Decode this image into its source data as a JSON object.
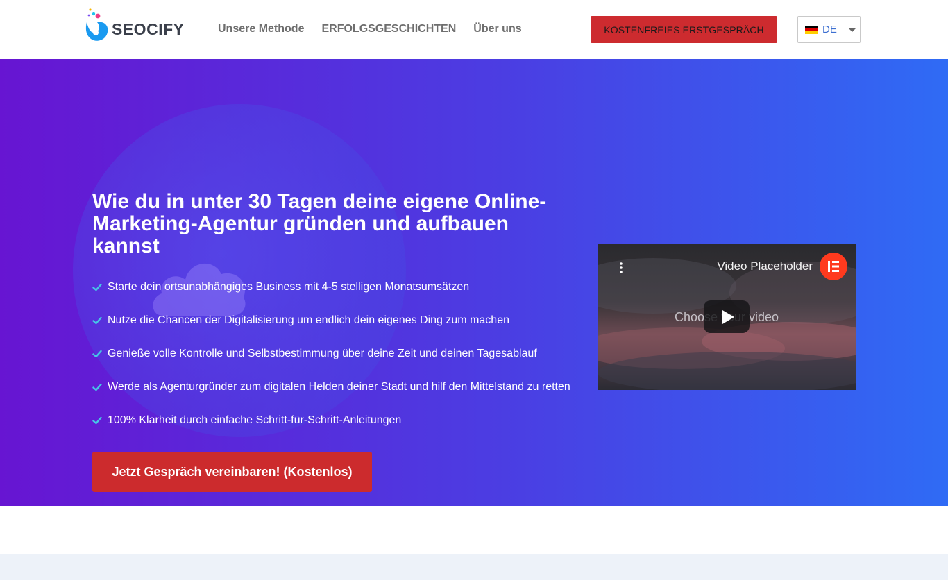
{
  "header": {
    "logo_text": "SEOCIFY",
    "nav": [
      {
        "label": "Unsere Methode"
      },
      {
        "label": "ERFOLGSGESCHICHTEN"
      },
      {
        "label": "Über uns"
      }
    ],
    "cta_label": "KOSTENFREIES ERSTGESPRÄCH",
    "language": {
      "code": "DE",
      "flag": [
        "#000000",
        "#dd0000",
        "#ffce00"
      ]
    }
  },
  "hero": {
    "title": "Wie du in unter 30 Tagen deine eigene Online-Marketing-Agentur gründen und aufbauen kannst",
    "features": [
      "Starte dein ortsunabhängiges Business mit 4-5 stelligen Monatsumsätzen",
      "Nutze die Chancen der Digitalisierung um endlich dein eigenes Ding zum machen",
      "Genieße volle Kontrolle und Selbstbestimmung über deine Zeit und deinen Tagesablauf",
      "Werde als Agenturgründer zum digitalen Helden deiner Stadt und hilf den Mittelstand zu retten",
      "100% Klarheit durch einfache Schritt-für-Schritt-Anleitungen"
    ],
    "button_label": "Jetzt Gespräch vereinbaren! (Kostenlos)"
  },
  "video": {
    "title": "Video Placeholder",
    "overlay_text": "Choose your video"
  },
  "colors": {
    "accent_red": "#cd2b2f",
    "hero_gradient_start": "#6715d2",
    "hero_gradient_end": "#2f6bf5",
    "check_color": "#46c6e6"
  }
}
